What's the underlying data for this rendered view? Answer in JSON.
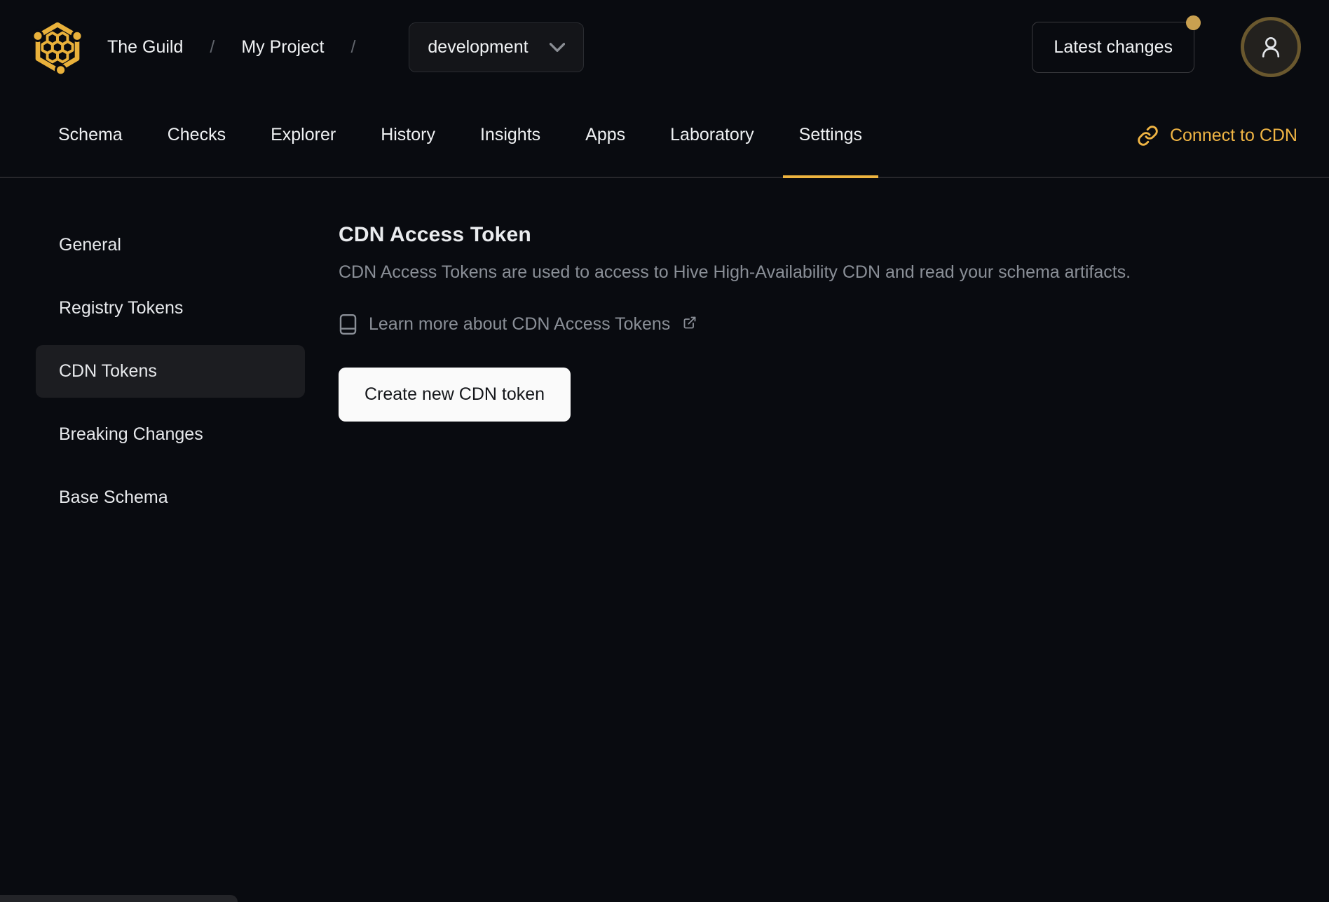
{
  "colors": {
    "accent_gold": "#eeb43f",
    "link_gold": "#f0b544",
    "notification_dot": "#c9a050",
    "background": "#090b10",
    "button_bg": "#fafafa"
  },
  "header": {
    "org": "The Guild",
    "project": "My Project",
    "separator": "/",
    "target_dropdown": {
      "selected": "development"
    },
    "latest_changes": {
      "label": "Latest changes",
      "has_notification": true
    }
  },
  "nav": {
    "tabs": [
      {
        "label": "Schema",
        "active": false
      },
      {
        "label": "Checks",
        "active": false
      },
      {
        "label": "Explorer",
        "active": false
      },
      {
        "label": "History",
        "active": false
      },
      {
        "label": "Insights",
        "active": false
      },
      {
        "label": "Apps",
        "active": false
      },
      {
        "label": "Laboratory",
        "active": false
      },
      {
        "label": "Settings",
        "active": true
      }
    ],
    "connect_cdn": "Connect to CDN"
  },
  "sidebar": {
    "items": [
      {
        "label": "General",
        "active": false
      },
      {
        "label": "Registry Tokens",
        "active": false
      },
      {
        "label": "CDN Tokens",
        "active": true
      },
      {
        "label": "Breaking Changes",
        "active": false
      },
      {
        "label": "Base Schema",
        "active": false
      }
    ]
  },
  "main": {
    "title": "CDN Access Token",
    "description": "CDN Access Tokens are used to access to Hive High-Availability CDN and read your schema artifacts.",
    "learn_more": "Learn more about CDN Access Tokens",
    "create_button": "Create new CDN token"
  }
}
